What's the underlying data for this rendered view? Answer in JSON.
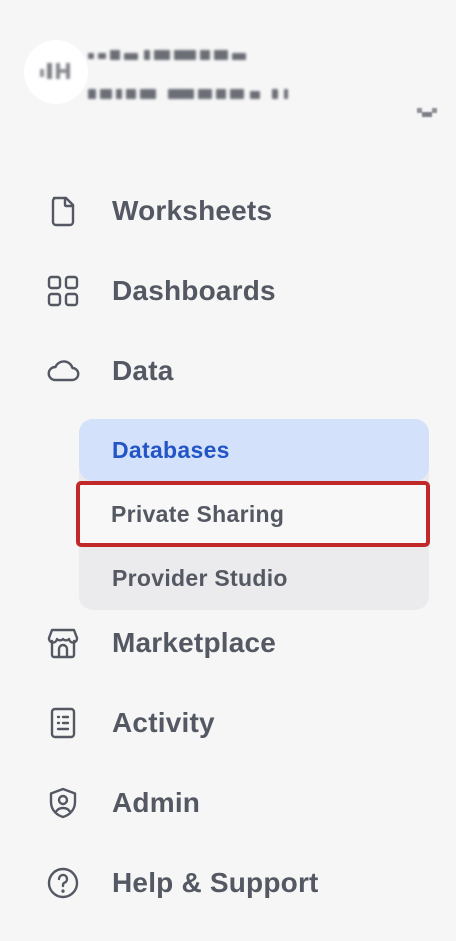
{
  "account": {
    "avatar_initials": "JH",
    "name_label": "",
    "sub_label": "",
    "chevron_icon": "chevron-down-icon"
  },
  "nav": {
    "items": [
      {
        "label": "Worksheets",
        "icon": "document-icon"
      },
      {
        "label": "Dashboards",
        "icon": "grid-icon"
      },
      {
        "label": "Data",
        "icon": "cloud-icon"
      },
      {
        "label": "Marketplace",
        "icon": "store-icon"
      },
      {
        "label": "Activity",
        "icon": "activity-list-icon"
      },
      {
        "label": "Admin",
        "icon": "shield-user-icon"
      },
      {
        "label": "Help & Support",
        "icon": "help-circle-icon"
      }
    ]
  },
  "data_subnav": {
    "items": [
      {
        "label": "Databases",
        "state": "active"
      },
      {
        "label": "Private Sharing",
        "state": "highlighted"
      },
      {
        "label": "Provider Studio",
        "state": "default"
      }
    ]
  },
  "colors": {
    "background": "#f6f6f6",
    "text": "#545863",
    "active_bg": "#d3e1fb",
    "active_text": "#2355c7",
    "highlight_border": "#c0282a",
    "subgroup_bg": "#ebebed"
  }
}
